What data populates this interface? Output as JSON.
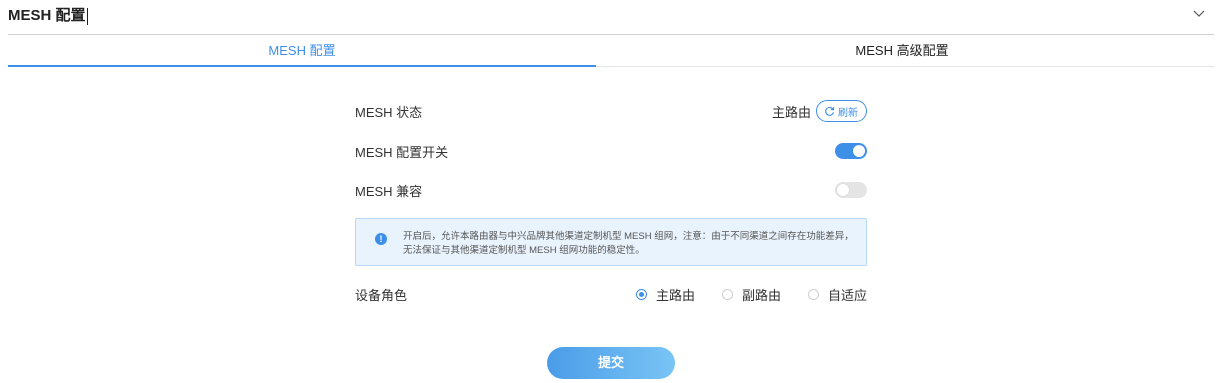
{
  "header": {
    "title": "MESH 配置",
    "chevron_icon": "chevron-down-icon"
  },
  "tabs": [
    {
      "label": "MESH 配置",
      "active": true
    },
    {
      "label": "MESH 高级配置",
      "active": false
    }
  ],
  "form": {
    "status": {
      "label": "MESH 状态",
      "value": "主路由",
      "refresh_label": "刷新",
      "refresh_icon": "refresh-icon"
    },
    "mesh_switch": {
      "label": "MESH 配置开关",
      "on": true
    },
    "mesh_compat": {
      "label": "MESH 兼容",
      "on": false
    },
    "notice": {
      "icon": "info-icon",
      "icon_glyph": "!",
      "text": "开启后，允许本路由器与中兴品牌其他渠道定制机型 MESH 组网，注意：由于不同渠道之间存在功能差异，无法保证与其他渠道定制机型 MESH 组网功能的稳定性。"
    },
    "device_role": {
      "label": "设备角色",
      "options": [
        {
          "label": "主路由",
          "checked": true
        },
        {
          "label": "副路由",
          "checked": false
        },
        {
          "label": "自适应",
          "checked": false
        }
      ]
    }
  },
  "submit_label": "提交",
  "colors": {
    "accent": "#3d8fe8",
    "notice_bg": "#e9f3fd",
    "notice_border": "#b9d8f5"
  }
}
